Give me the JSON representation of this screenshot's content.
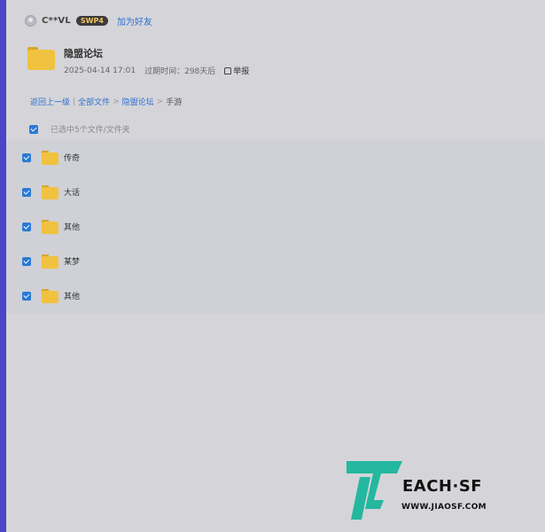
{
  "user": {
    "name": "C**VL",
    "badge": "SWP4",
    "add_friend": "加为好友"
  },
  "share": {
    "title": "隐盟论坛",
    "date": "2025-04-14 17:01",
    "expiry": "过期时间：298天后",
    "report": "举报"
  },
  "breadcrumb": {
    "back": "返回上一级",
    "divider": "|",
    "all_files": "全部文件",
    "sep1": ">",
    "forum": "隐盟论坛",
    "sep2": ">",
    "current": "手游"
  },
  "selection": {
    "summary": "已选中5个文件/文件夹"
  },
  "items": [
    {
      "name": "传奇"
    },
    {
      "name": "大话"
    },
    {
      "name": "其他"
    },
    {
      "name": "某梦"
    },
    {
      "name": "其他"
    }
  ],
  "watermark": {
    "brand": "EACH·SF",
    "url": "WWW.JIAOSF.COM",
    "colors": {
      "logo": "#23b89f",
      "text": "#111111"
    }
  },
  "colors": {
    "accent": "#4b45c8",
    "link": "#2f6fd1",
    "checkbox": "#2a79d4",
    "folder": "#f1c23f"
  }
}
